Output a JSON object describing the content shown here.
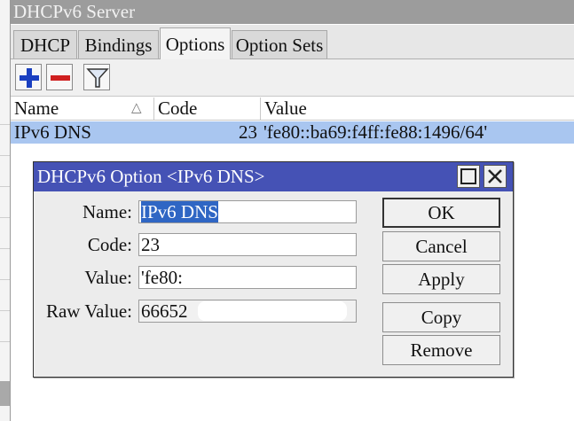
{
  "window": {
    "title": "DHCPv6 Server"
  },
  "tabs": [
    {
      "label": "DHCP"
    },
    {
      "label": "Bindings"
    },
    {
      "label": "Options",
      "active": true
    },
    {
      "label": "Option Sets"
    }
  ],
  "toolbar": {
    "add_icon": "plus-icon",
    "remove_icon": "minus-icon",
    "filter_icon": "filter-icon"
  },
  "table": {
    "columns": [
      "Name",
      "Code",
      "Value"
    ],
    "sort_column": "Name",
    "rows": [
      {
        "name": "IPv6 DNS",
        "code": "23",
        "value": "'fe80::ba69:f4ff:fe88:1496/64'",
        "selected": true
      }
    ]
  },
  "dialog": {
    "title": "DHCPv6 Option <IPv6 DNS>",
    "maximize_icon": "maximize-icon",
    "close_icon": "close-icon",
    "fields": {
      "name": {
        "label": "Name:",
        "value": "IPv6 DNS"
      },
      "code": {
        "label": "Code:",
        "value": "23"
      },
      "value": {
        "label": "Value:",
        "value": "'fe80:"
      },
      "raw_value": {
        "label": "Raw Value:",
        "value": "66652"
      }
    },
    "buttons": {
      "ok": "OK",
      "cancel": "Cancel",
      "apply": "Apply",
      "copy": "Copy",
      "remove": "Remove"
    }
  },
  "colors": {
    "title_bar": "#9c9c9c",
    "dialog_title": "#4552b5",
    "selected_row": "#a9c6f0",
    "selection": "#2f66c4",
    "add_icon": "#1a3fc0",
    "remove_icon": "#d02020"
  }
}
